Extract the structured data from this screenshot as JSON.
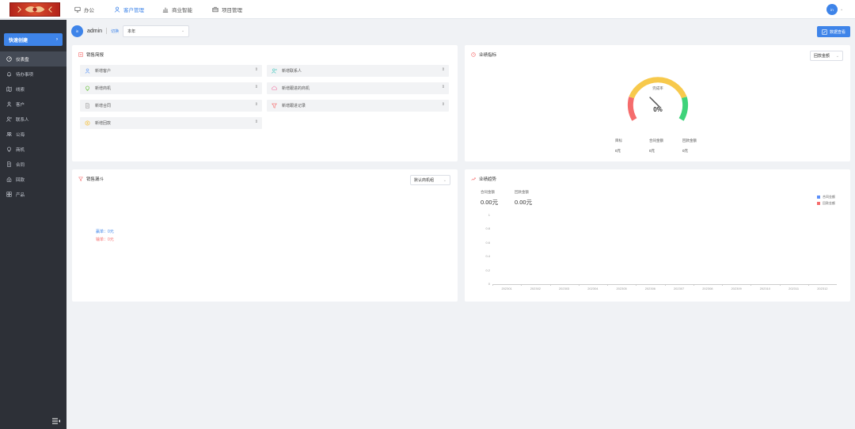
{
  "topnav": [
    {
      "label": "办公",
      "icon": "monitor-icon",
      "active": false
    },
    {
      "label": "客户管理",
      "icon": "user-icon",
      "active": true
    },
    {
      "label": "商业智能",
      "icon": "bar-chart-icon",
      "active": false
    },
    {
      "label": "项目管理",
      "icon": "briefcase-icon",
      "active": false
    }
  ],
  "user": {
    "avatar_text": "in"
  },
  "sidebar": {
    "quick_label": "快速创建",
    "items": [
      {
        "label": "仪表盘",
        "icon": "dashboard-icon",
        "active": true
      },
      {
        "label": "待办事项",
        "icon": "bell-icon"
      },
      {
        "label": "线索",
        "icon": "map-icon"
      },
      {
        "label": "客户",
        "icon": "user-icon"
      },
      {
        "label": "联系人",
        "icon": "contact-icon"
      },
      {
        "label": "公海",
        "icon": "users-icon"
      },
      {
        "label": "商机",
        "icon": "bulb-icon"
      },
      {
        "label": "合同",
        "icon": "contract-icon"
      },
      {
        "label": "回款",
        "icon": "money-icon"
      },
      {
        "label": "产品",
        "icon": "product-icon"
      }
    ]
  },
  "header": {
    "avatar_text": "in",
    "username": "admin",
    "switch_label": "切换",
    "scope_value": "本年",
    "data_button": "数据查看"
  },
  "sales_brief": {
    "title": "销售简报",
    "items": [
      {
        "label": "新增客户",
        "icon": "user-icon",
        "color": "#6a9ef5"
      },
      {
        "label": "新增联系人",
        "icon": "contact-icon",
        "color": "#4cc9c0"
      },
      {
        "label": "新增商机",
        "icon": "bulb-icon",
        "color": "#67c23a"
      },
      {
        "label": "新增跟进的商机",
        "icon": "cloud-icon",
        "color": "#f08bb0"
      },
      {
        "label": "新增合同",
        "icon": "contract-icon",
        "color": "#999999"
      },
      {
        "label": "新增跟进记录",
        "icon": "funnel-icon",
        "color": "#f56c6c"
      },
      {
        "label": "新增回款",
        "icon": "coin-icon",
        "color": "#f5c242"
      }
    ]
  },
  "goal": {
    "title": "业绩指标",
    "select": "回款金额",
    "gauge_label": "完成率",
    "gauge_value": "0%",
    "percent": 0,
    "stats": [
      {
        "label": "目标",
        "value": "0元"
      },
      {
        "label": "合同金额",
        "value": "0元"
      },
      {
        "label": "回款金额",
        "value": "0元"
      }
    ]
  },
  "funnel": {
    "title": "销售漏斗",
    "select": "默认商机组",
    "win_text": "赢单：0元",
    "lose_text": "输单：0元"
  },
  "performance": {
    "title": "业绩趋势",
    "metrics": [
      {
        "label": "合同金额",
        "value": "0.00元"
      },
      {
        "label": "回款金额",
        "value": "0.00元"
      }
    ]
  },
  "chart_data": {
    "type": "bar",
    "categories": [
      "202301",
      "202302",
      "202303",
      "202304",
      "202305",
      "202306",
      "202307",
      "202308",
      "202309",
      "202310",
      "202311",
      "202312"
    ],
    "series": [
      {
        "name": "合同金额",
        "color": "#5b8ff9",
        "values": [
          0,
          0,
          0,
          0,
          0,
          0,
          0,
          0,
          0,
          0,
          0,
          0
        ]
      },
      {
        "name": "回款金额",
        "color": "#f56c6c",
        "values": [
          0,
          0,
          0,
          0,
          0,
          0,
          0,
          0,
          0,
          0,
          0,
          0
        ]
      }
    ],
    "yticks": [
      "1",
      "0.8",
      "0.6",
      "0.4",
      "0.2",
      "0"
    ],
    "ylim": [
      0,
      1
    ],
    "legend": "top-right",
    "grid": false
  }
}
